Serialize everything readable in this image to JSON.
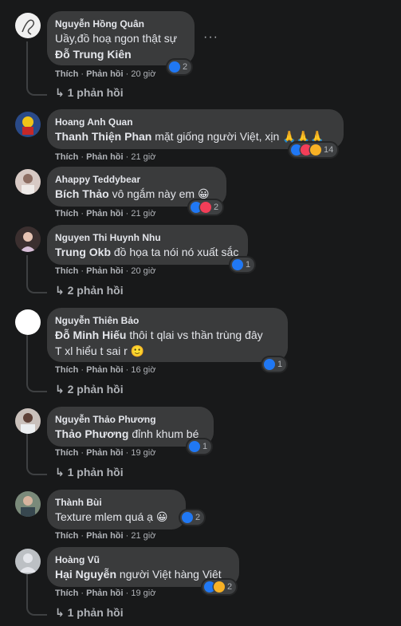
{
  "actions": {
    "like": "Thích",
    "reply": "Phản hồi"
  },
  "colors": {
    "background": "#18191a",
    "bubble": "#3a3b3c",
    "like": "#2078f4",
    "love": "#f33e58",
    "haha": "#f7b125"
  },
  "comments": [
    {
      "author": "Nguyễn Hồng Quân",
      "text": "Uầy,đồ hoạ ngon thật sự",
      "mention": "Đỗ Trung Kiên",
      "time": "20 giờ",
      "reaction_count": "2",
      "replies": "1 phản hồi",
      "more": "···"
    },
    {
      "author": "Hoang Anh Quan",
      "mention": "Thanh Thiện Phan",
      "text": "mặt giống người Việt, xịn 🙏🙏🙏",
      "time": "21 giờ",
      "reaction_count": "14"
    },
    {
      "author": "Ahappy Teddybear",
      "mention": "Bích Thảo",
      "text": "vô ngắm này em 😀",
      "time": "21 giờ",
      "reaction_count": "2"
    },
    {
      "author": "Nguyen Thi Huynh Nhu",
      "mention": "Trung Okb",
      "text": "đồ họa ta nói nó xuất sắc",
      "time": "20 giờ",
      "reaction_count": "1",
      "replies": "2 phản hồi"
    },
    {
      "author": "Nguyễn Thiên Bảo",
      "mention": "Đỗ Minh Hiếu",
      "text": "thôi t qlai vs thần trùng đây",
      "text2": "T xl hiểu t sai r 🙂",
      "time": "16 giờ",
      "reaction_count": "1",
      "replies": "2 phản hồi"
    },
    {
      "author": "Nguyễn Thảo Phương",
      "mention": "Thảo Phương",
      "text": "đỉnh khum bé",
      "time": "19 giờ",
      "reaction_count": "1",
      "replies": "1 phản hồi"
    },
    {
      "author": "Thành Bùi",
      "text": "Texture mlem quá ạ 😀",
      "time": "21 giờ",
      "reaction_count": "2"
    },
    {
      "author": "Hoàng Vũ",
      "mention": "Hại Nguyễn",
      "text": "người Việt hàng Việt",
      "time": "19 giờ",
      "reaction_count": "2",
      "replies": "1 phản hồi"
    }
  ]
}
